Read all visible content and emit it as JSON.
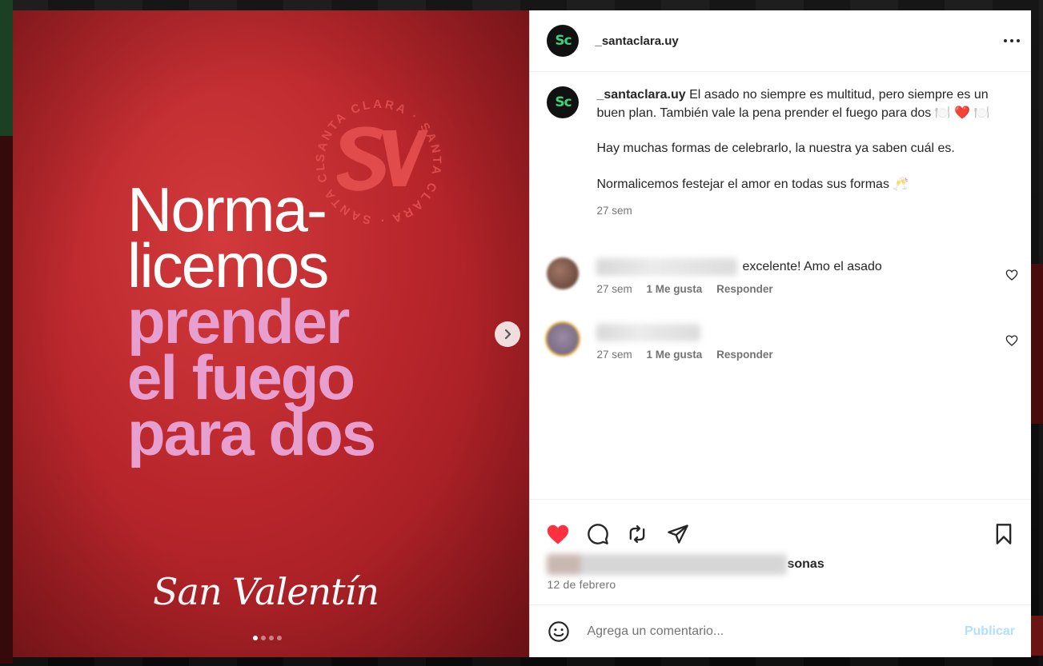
{
  "post": {
    "username": "_santaclara.uy",
    "avatar_text": "Sc",
    "more_icon": "more-horizontal-icon"
  },
  "media": {
    "headline_white": [
      "Norma-",
      "licemos"
    ],
    "headline_pink": [
      "prender",
      "el fuego",
      "para dos"
    ],
    "seal_ring_text": "SANTA CLARA · SANTA CLARA · SANTA CLARA ·",
    "seal_monogram": "SV",
    "script_text": "San Valentín",
    "slides_total": 4,
    "slide_active": 1,
    "next_icon": "chevron-right-icon"
  },
  "caption": {
    "username": "_santaclara.uy",
    "line1": "El asado no siempre es multitud, pero siempre es un buen plan. También vale la pena prender el fuego para dos",
    "emojis1": "🍽️ ❤️ 🍽️",
    "line2": "Hay muchas formas de celebrarlo, la nuestra ya saben cuál es.",
    "line3": "Normalicemos festejar el amor en todas sus formas",
    "emoji3": "🥂",
    "time": "27 sem"
  },
  "comments": [
    {
      "text": "excelente! Amo el asado",
      "time": "27 sem",
      "likes": "1 Me gusta",
      "reply": "Responder"
    },
    {
      "text": "",
      "time": "27 sem",
      "likes": "1 Me gusta",
      "reply": "Responder"
    }
  ],
  "likes_suffix": "sonas",
  "date": "12 de febrero",
  "composer": {
    "placeholder": "Agrega un comentario...",
    "publish": "Publicar"
  },
  "colors": {
    "liked_heart": "#ff3040",
    "publish_disabled": "#b2dffc",
    "media_red": "#b8262b",
    "headline_pink": "#e79fd0",
    "avatar_green": "#3fd07a"
  }
}
